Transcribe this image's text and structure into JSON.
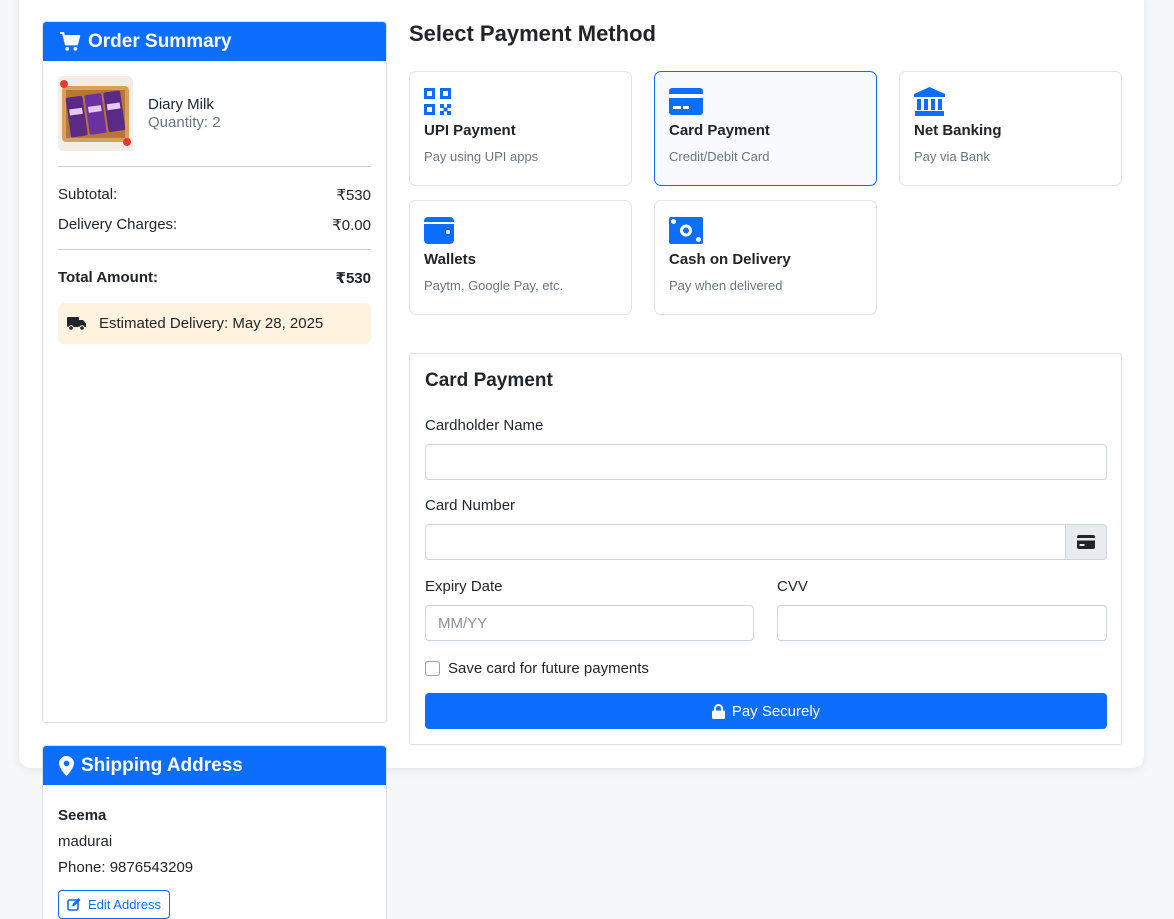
{
  "order_summary": {
    "title": "Order Summary",
    "product": {
      "name": "Diary Milk",
      "quantity": "Quantity: 2"
    },
    "subtotal_label": "Subtotal:",
    "subtotal_value": "₹530",
    "delivery_label": "Delivery Charges:",
    "delivery_value": "₹0.00",
    "total_label": "Total Amount:",
    "total_value": "₹530",
    "estimated_delivery": "Estimated Delivery: May 28, 2025"
  },
  "shipping": {
    "title": "Shipping Address",
    "name": "Seema",
    "city": "madurai",
    "phone": "Phone: 9876543209",
    "edit_label": "Edit Address"
  },
  "payment": {
    "title": "Select Payment Method",
    "methods": [
      {
        "name": "UPI Payment",
        "desc": "Pay using UPI apps",
        "icon": "qrcode-icon"
      },
      {
        "name": "Card Payment",
        "desc": "Credit/Debit Card",
        "icon": "credit-card-icon",
        "selected": true
      },
      {
        "name": "Net Banking",
        "desc": "Pay via Bank",
        "icon": "bank-icon"
      },
      {
        "name": "Wallets",
        "desc": "Paytm, Google Pay, etc.",
        "icon": "wallet-icon"
      },
      {
        "name": "Cash on Delivery",
        "desc": "Pay when delivered",
        "icon": "cash-icon"
      }
    ]
  },
  "card_form": {
    "title": "Card Payment",
    "cardholder_label": "Cardholder Name",
    "cardholder_value": "",
    "card_number_label": "Card Number",
    "card_number_value": "",
    "expiry_label": "Expiry Date",
    "expiry_placeholder": "MM/YY",
    "cvv_label": "CVV",
    "cvv_value": "",
    "save_card_label": "Save card for future payments",
    "save_card_checked": false,
    "pay_label": "Pay Securely"
  },
  "colors": {
    "primary": "#0d6efd",
    "delivery_bg": "#fff3e0",
    "selected_bg": "#f7f9fc"
  }
}
